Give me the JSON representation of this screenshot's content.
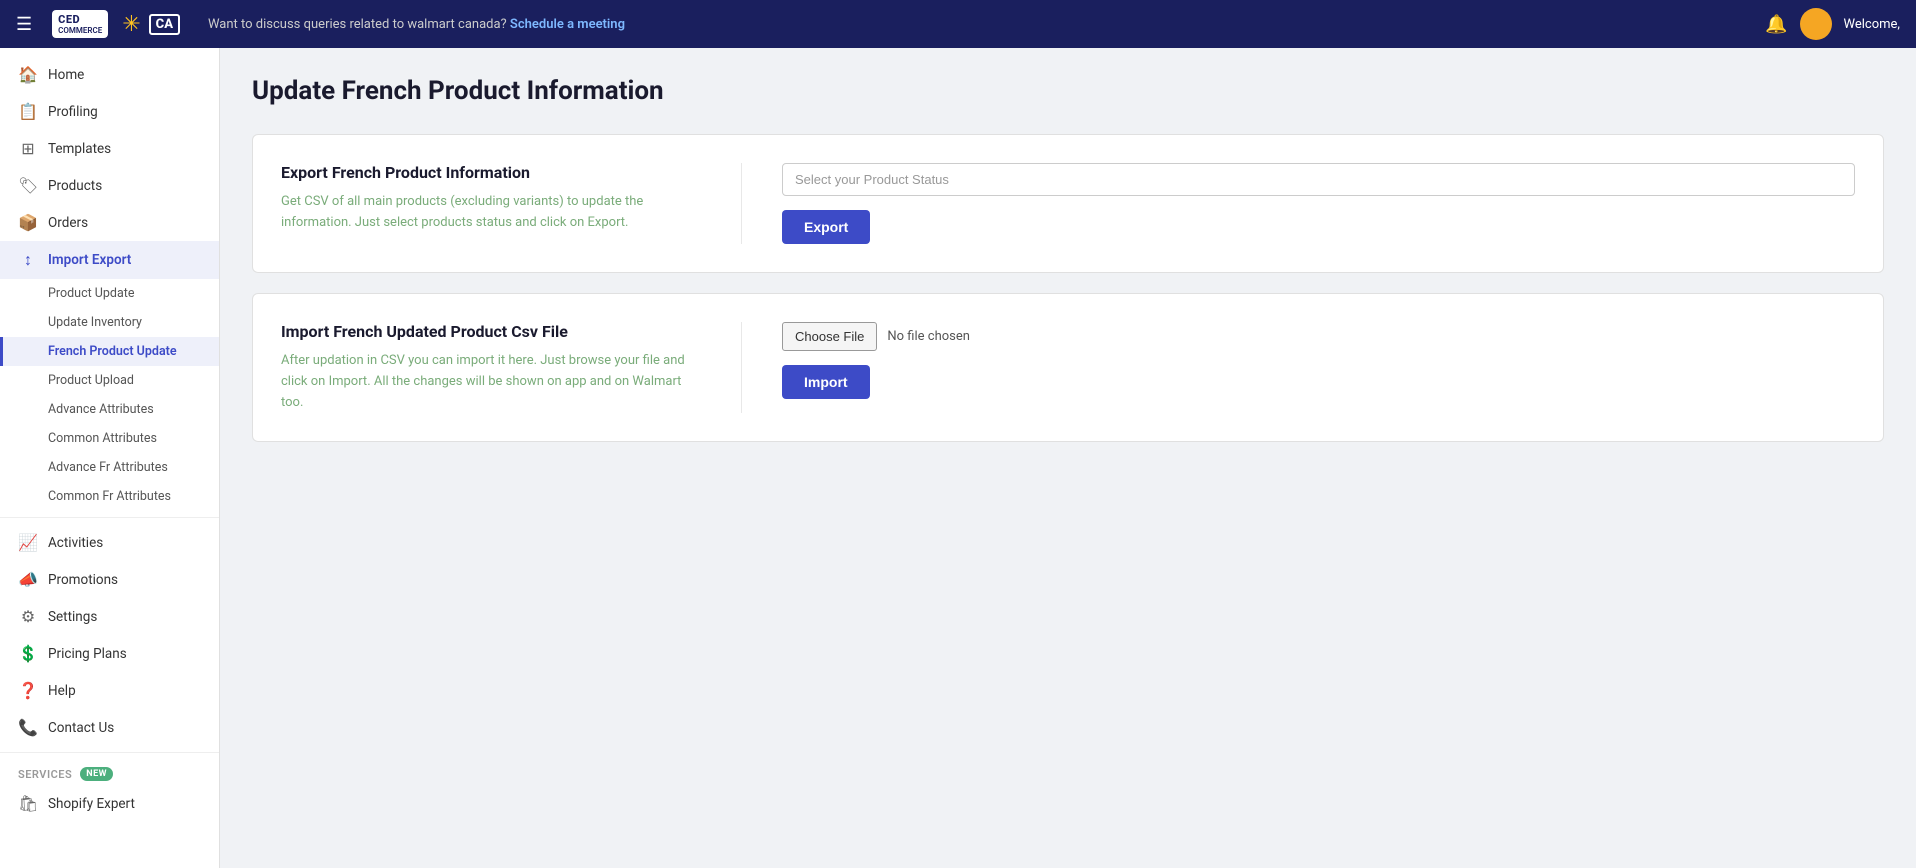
{
  "topbar": {
    "hamburger": "☰",
    "logo_text": "CED",
    "logo_sub": "COMMERCE",
    "walmart_star": "✳",
    "notice": "Want to discuss queries related to walmart canada?",
    "notice_link": "Schedule a meeting",
    "welcome": "Welcome,",
    "bell": "🔔"
  },
  "sidebar": {
    "items": [
      {
        "id": "home",
        "label": "Home",
        "icon": "🏠"
      },
      {
        "id": "profiling",
        "label": "Profiling",
        "icon": "📋"
      },
      {
        "id": "templates",
        "label": "Templates",
        "icon": "⊞"
      },
      {
        "id": "products",
        "label": "Products",
        "icon": "🏷"
      },
      {
        "id": "orders",
        "label": "Orders",
        "icon": "📦"
      },
      {
        "id": "import-export",
        "label": "Import Export",
        "icon": "↕"
      }
    ],
    "sub_items": [
      {
        "id": "product-update",
        "label": "Product Update",
        "active": false
      },
      {
        "id": "update-inventory",
        "label": "Update Inventory",
        "active": false
      },
      {
        "id": "french-product-update",
        "label": "French Product Update",
        "active": true
      },
      {
        "id": "product-upload",
        "label": "Product Upload",
        "active": false
      },
      {
        "id": "advance-attributes",
        "label": "Advance Attributes",
        "active": false
      },
      {
        "id": "common-attributes",
        "label": "Common Attributes",
        "active": false
      },
      {
        "id": "advance-fr-attributes",
        "label": "Advance Fr Attributes",
        "active": false
      },
      {
        "id": "common-fr-attributes",
        "label": "Common Fr Attributes",
        "active": false
      }
    ],
    "bottom_items": [
      {
        "id": "activities",
        "label": "Activities",
        "icon": "📈"
      },
      {
        "id": "promotions",
        "label": "Promotions",
        "icon": "📣"
      },
      {
        "id": "settings",
        "label": "Settings",
        "icon": "⚙"
      },
      {
        "id": "pricing-plans",
        "label": "Pricing Plans",
        "icon": "💲"
      },
      {
        "id": "help",
        "label": "Help",
        "icon": "❓"
      },
      {
        "id": "contact-us",
        "label": "Contact Us",
        "icon": "📞"
      }
    ],
    "services_label": "SERVICES",
    "badge_new": "NEW",
    "shopify_expert": "Shopify Expert",
    "shopify_icon": "🛍"
  },
  "page": {
    "title": "Update French Product Information",
    "export_section": {
      "title": "Export French Product Information",
      "description": "Get CSV of all main products (excluding variants) to update the information. Just select products status and click on Export.",
      "select_placeholder": "Select your Product Status",
      "export_btn": "Export"
    },
    "import_section": {
      "title": "Import French Updated Product Csv File",
      "description": "After updation in CSV you can import it here. Just browse your file and click on Import. All the changes will be shown on app and on Walmart too.",
      "choose_file_btn": "Choose File",
      "no_file_text": "No file chosen",
      "import_btn": "Import"
    }
  }
}
